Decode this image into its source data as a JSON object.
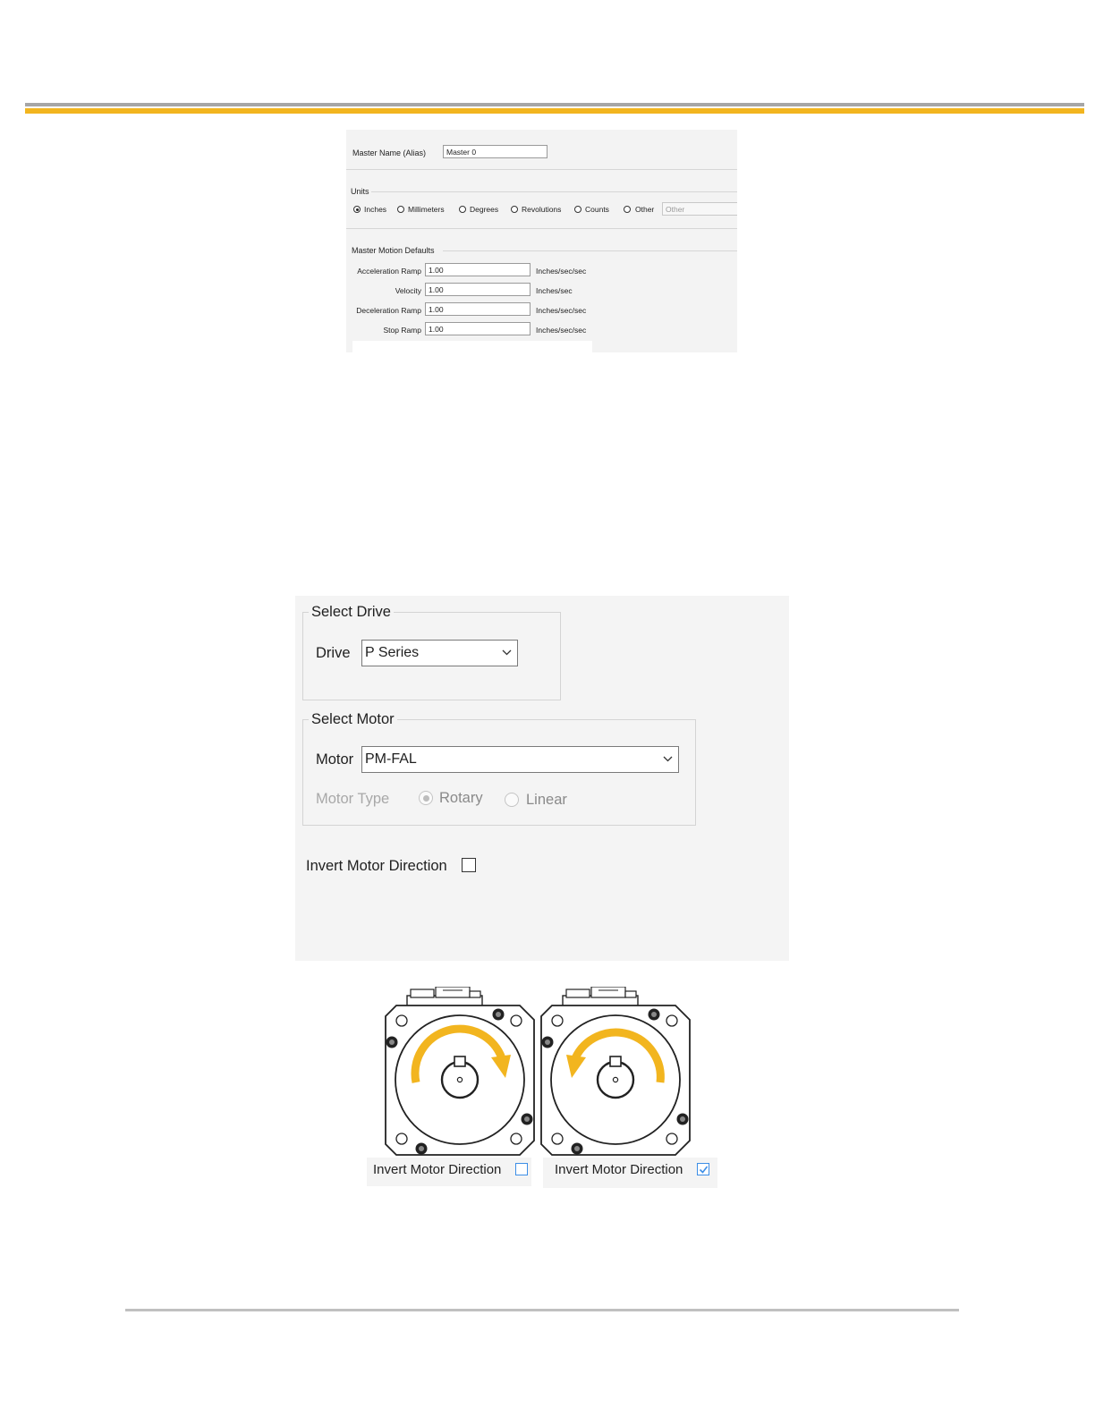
{
  "master_settings": {
    "name_label": "Master Name (Alias)",
    "name_value": "Master 0",
    "units_group": "Units",
    "units": [
      "Inches",
      "Millimeters",
      "Degrees",
      "Revolutions",
      "Counts",
      "Other"
    ],
    "selected_unit": "Inches",
    "other_placeholder": "Other",
    "defaults_group": "Master Motion Defaults",
    "fields": [
      {
        "label": "Acceleration Ramp",
        "value": "1.00",
        "unit": "Inches/sec/sec"
      },
      {
        "label": "Velocity",
        "value": "1.00",
        "unit": "Inches/sec"
      },
      {
        "label": "Deceleration Ramp",
        "value": "1.00",
        "unit": "Inches/sec/sec"
      },
      {
        "label": "Stop Ramp",
        "value": "1.00",
        "unit": "Inches/sec/sec"
      }
    ]
  },
  "drive_motor": {
    "drive_group": "Select Drive",
    "drive_label": "Drive",
    "drive_value": "P Series",
    "motor_group": "Select Motor",
    "motor_label": "Motor",
    "motor_value": "PM-FAL",
    "motor_type_label": "Motor Type",
    "motor_type_options": [
      "Rotary",
      "Linear"
    ],
    "motor_type_selected": "Rotary",
    "invert_label": "Invert Motor Direction",
    "invert_checked": false
  },
  "diagram": {
    "left_caption": "Invert Motor Direction",
    "left_checked": false,
    "right_caption": "Invert Motor Direction",
    "right_checked": true,
    "arrow_color": "#f2b51f",
    "check_color": "#3d8ee6"
  }
}
